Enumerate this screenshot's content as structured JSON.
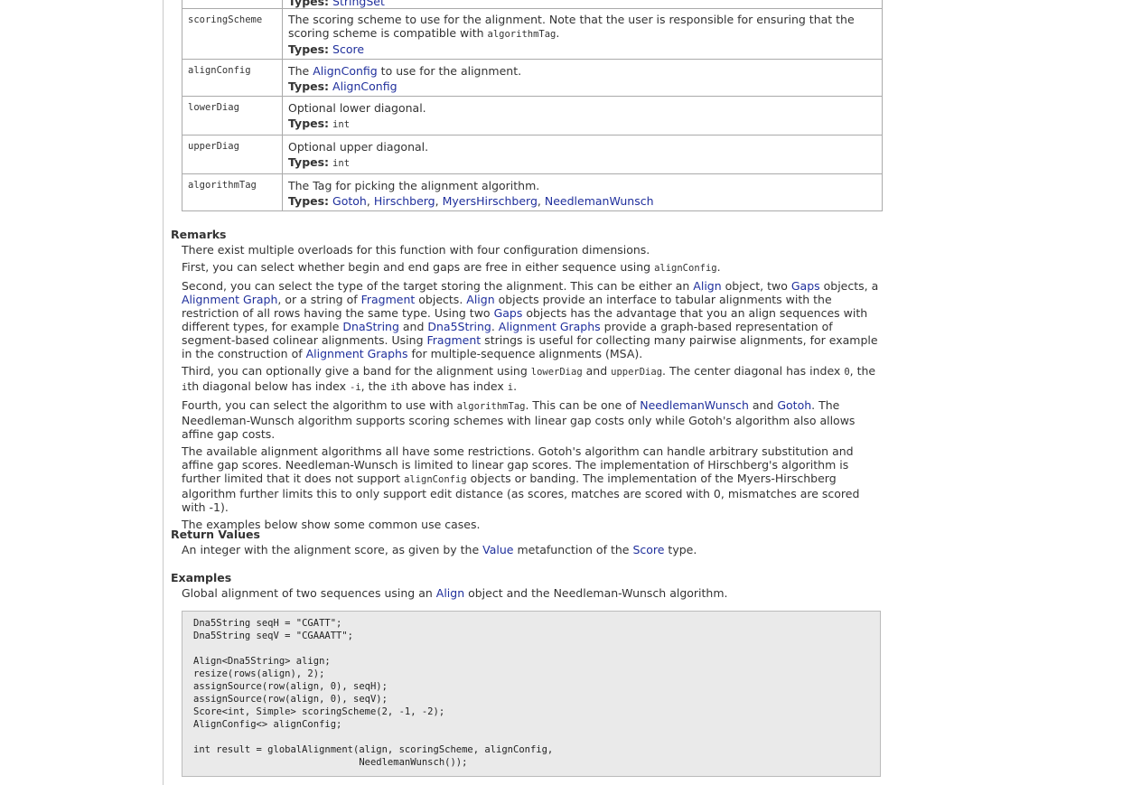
{
  "params": {
    "row0": {
      "types_label": "Types:",
      "types": [
        "StringSet"
      ]
    },
    "row1": {
      "name": "scoringScheme",
      "desc_a": "The scoring scheme to use for the alignment. Note that the user is responsible for ensuring that the scoring scheme is compatible with ",
      "desc_code": "algorithmTag",
      "desc_b": ".",
      "types_label": "Types:",
      "types": [
        "Score"
      ]
    },
    "row2": {
      "name": "alignConfig",
      "desc_a": "The ",
      "desc_link": "AlignConfig",
      "desc_b": " to use for the alignment.",
      "types_label": "Types:",
      "types": [
        "AlignConfig"
      ]
    },
    "row3": {
      "name": "lowerDiag",
      "desc": "Optional lower diagonal.",
      "types_label": "Types:",
      "type_code": "int"
    },
    "row4": {
      "name": "upperDiag",
      "desc": "Optional upper diagonal.",
      "types_label": "Types:",
      "type_code": "int"
    },
    "row5": {
      "name": "algorithmTag",
      "desc": "The Tag for picking the alignment algorithm.",
      "types_label": "Types:",
      "types": [
        "Gotoh",
        "Hirschberg",
        "MyersHirschberg",
        "NeedlemanWunsch"
      ]
    }
  },
  "remarks": {
    "title": "Remarks",
    "p1": "There exist multiple overloads for this function with four configuration dimensions.",
    "p2": {
      "a": "First, you can select whether begin and end gaps are free in either sequence using ",
      "code": "alignConfig",
      "b": "."
    },
    "p3": {
      "t1": "Second, you can select the type of the target storing the alignment. This can be either an ",
      "l1": "Align",
      "t2": " object, two ",
      "l2": "Gaps",
      "t3": " objects, a ",
      "l3": "Alignment Graph",
      "t4": ", or a string of ",
      "l4": "Fragment",
      "t5": " objects. ",
      "l5": "Align",
      "t6": " objects provide an interface to tabular alignments with the restriction of all rows having the same type. Using two ",
      "l6": "Gaps",
      "t7": " objects has the advantage that you an align sequences with different types, for example ",
      "l7": "DnaString",
      "t8": " and ",
      "l8": "Dna5String",
      "t9": ". ",
      "l9": "Alignment Graphs",
      "t10": " provide a graph-based representation of segment-based colinear alignments. Using ",
      "l10": "Fragment",
      "t11": " strings is useful for collecting many pairwise alignments, for example in the construction of ",
      "l11": "Alignment Graphs",
      "t12": " for multiple-sequence alignments (MSA)."
    },
    "p4": {
      "t1": "Third, you can optionally give a band for the alignment using ",
      "c1": "lowerDiag",
      "t2": " and ",
      "c2": "upperDiag",
      "t3": ". The center diagonal has index ",
      "c3": "0",
      "t4": ", the ",
      "c4": "i",
      "t5": "th diagonal below has index ",
      "c5": "-i",
      "t6": ", the ",
      "c6": "i",
      "t7": "th above has index ",
      "c7": "i",
      "t8": "."
    },
    "p5": {
      "t1": "Fourth, you can select the algorithm to use with ",
      "c1": "algorithmTag",
      "t2": ". This can be one of ",
      "l1": "NeedlemanWunsch",
      "t3": " and ",
      "l2": "Gotoh",
      "t4": ". The Needleman-Wunsch algorithm supports scoring schemes with linear gap costs only while Gotoh's algorithm also allows affine gap costs."
    },
    "p6": {
      "t1": "The available alignment algorithms all have some restrictions. Gotoh's algorithm can handle arbitrary substitution and affine gap scores. Needleman-Wunsch is limited to linear gap scores. The implementation of Hirschberg's algorithm is further limited that it does not support ",
      "c1": "alignConfig",
      "t2": " objects or banding. The implementation of the Myers-Hirschberg algorithm further limits this to only support edit distance (as scores, matches are scored with 0, mismatches are scored with -1)."
    },
    "p7": "The examples below show some common use cases."
  },
  "returns": {
    "title": "Return Values",
    "t1": "An integer with the alignment score, as given by the ",
    "l1": "Value",
    "t2": " metafunction of the ",
    "l2": "Score",
    "t3": " type."
  },
  "examples": {
    "title": "Examples",
    "t1": "Global alignment of two sequences using an ",
    "l1": "Align",
    "t2": " object and the Needleman-Wunsch algorithm.",
    "code": [
      "Dna5String seqH = \"CGATT\";",
      "Dna5String seqV = \"CGAAATT\";",
      "",
      "Align<Dna5String> align;",
      "resize(rows(align), 2);",
      "assignSource(row(align, 0), seqH);",
      "assignSource(row(align, 0), seqV);",
      "Score<int, Simple> scoringScheme(2, -1, -2);",
      "AlignConfig<> alignConfig;",
      "",
      "int result = globalAlignment(align, scoringScheme, alignConfig,",
      "                             NeedlemanWunsch());"
    ]
  }
}
